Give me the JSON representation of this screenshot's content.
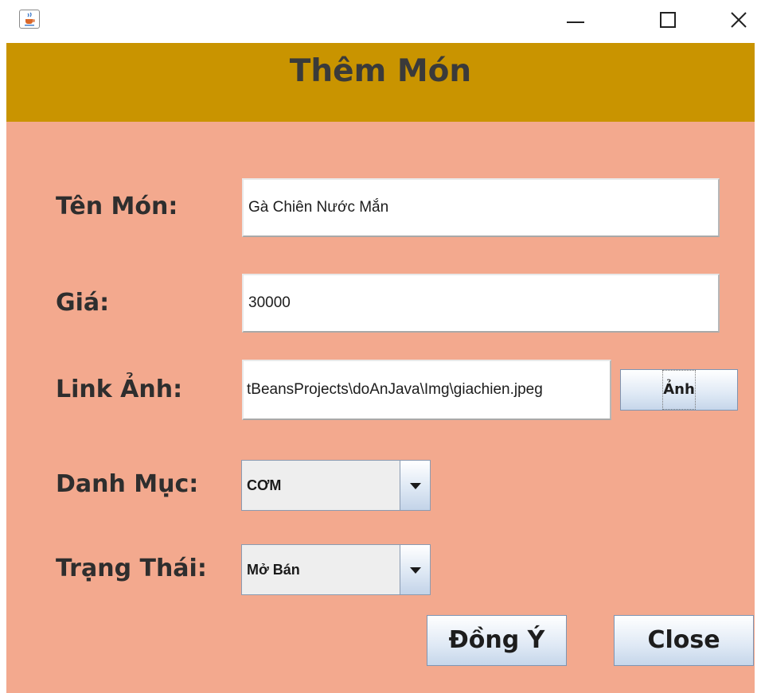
{
  "window": {
    "icons": {
      "app": "java-cup-icon",
      "minimize": "minimize-icon",
      "maximize": "maximize-icon",
      "close": "close-icon"
    }
  },
  "header": {
    "title": "Thêm Món"
  },
  "form": {
    "name": {
      "label": "Tên Món:",
      "value": "Gà Chiên Nước Mắn"
    },
    "price": {
      "label": "Giá:",
      "value": "30000"
    },
    "image": {
      "label": "Link Ảnh:",
      "value": "tBeansProjects\\doAnJava\\Img\\giachien.jpeg",
      "browse_label": "Ảnh"
    },
    "category": {
      "label": "Danh Mục:",
      "selected": "CƠM"
    },
    "status": {
      "label": "Trạng Thái:",
      "selected": "Mở Bán"
    }
  },
  "actions": {
    "ok_label": "Đồng Ý",
    "close_label": "Close"
  },
  "colors": {
    "header": "#c99400",
    "panel": "#f3a98e",
    "button_top": "#ffffff",
    "button_bottom": "#c6d6ea"
  }
}
